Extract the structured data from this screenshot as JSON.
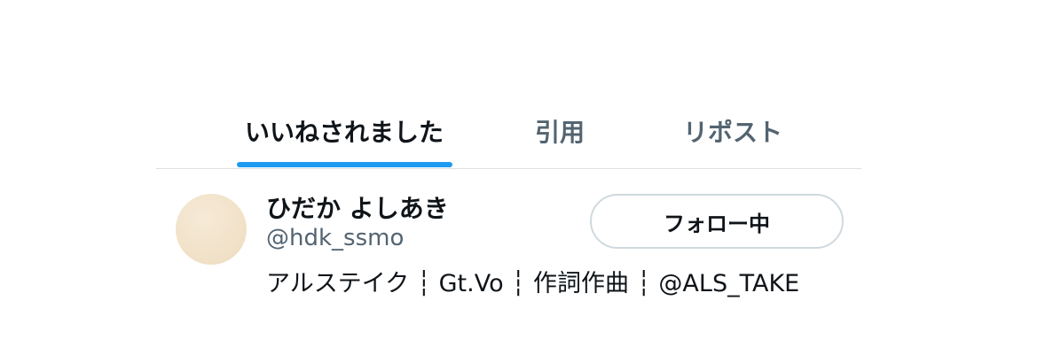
{
  "tabs": [
    {
      "label": "いいねされました",
      "active": true
    },
    {
      "label": "引用",
      "active": false
    },
    {
      "label": "リポスト",
      "active": false
    }
  ],
  "user": {
    "display_name": "ひだか よしあき",
    "handle": "@hdk_ssmo",
    "bio": "アルステイク ┆ Gt.Vo ┆ 作詞作曲 ┆ @ALS_TAKE",
    "follow_button_label": "フォロー中"
  },
  "colors": {
    "accent": "#1d9bf0",
    "text_primary": "#0f1419",
    "text_secondary": "#536471",
    "border": "#cfd9de"
  }
}
